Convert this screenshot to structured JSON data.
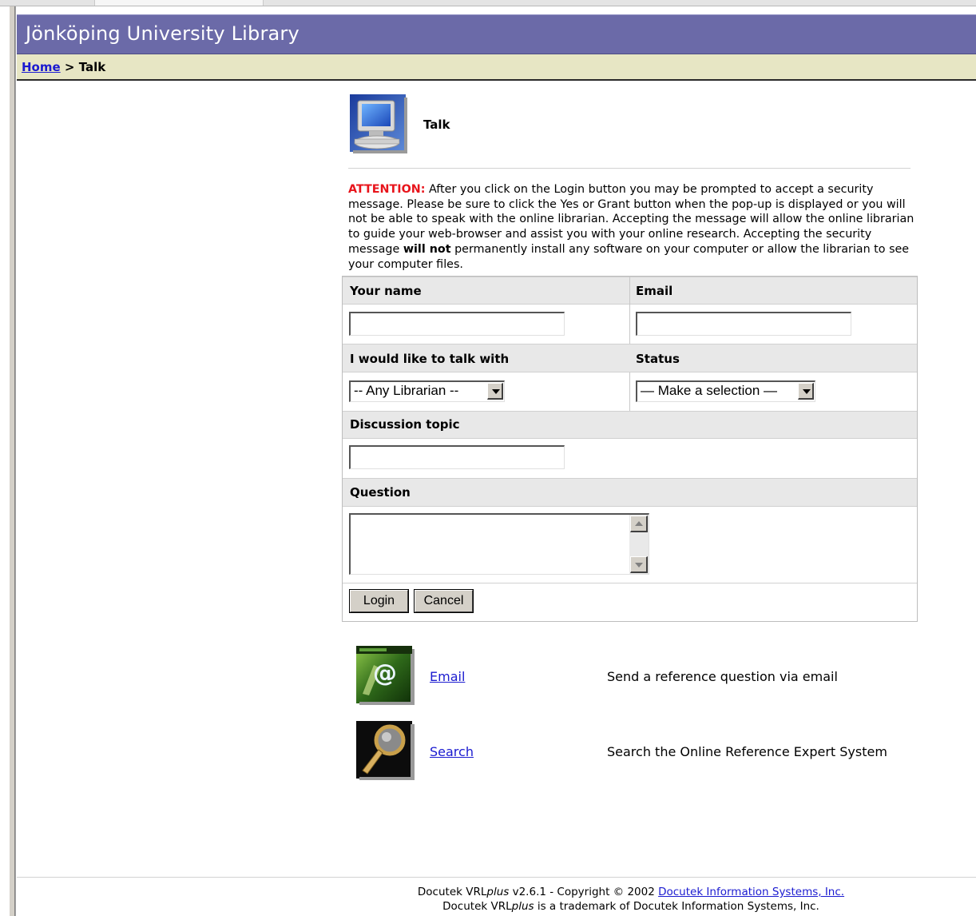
{
  "header": {
    "title": "Jönköping University Library"
  },
  "breadcrumb": {
    "home": "Home",
    "separator": ">",
    "current": "Talk"
  },
  "page": {
    "title": "Talk"
  },
  "attention": {
    "label": "ATTENTION:",
    "text_before": "After you click on the Login button you may be prompted to accept a security message. Please be sure to click the Yes or Grant button when the pop-up is displayed or you will not be able to speak with the online librarian. Accepting the message will allow the online librarian to guide your web-browser and assist you with your online research. Accepting the security message",
    "emphasis": "will not",
    "text_after": "permanently install any software on your computer or allow the librarian to see your computer files."
  },
  "form": {
    "name_label": "Your name",
    "name_value": "",
    "email_label": "Email",
    "email_value": "",
    "talk_with_label": "I would like to talk with",
    "talk_with_selected": "-- Any Librarian --",
    "status_label": "Status",
    "status_selected": "— Make a selection —",
    "topic_label": "Discussion topic",
    "topic_value": "",
    "question_label": "Question",
    "question_value": "",
    "login_label": "Login",
    "cancel_label": "Cancel"
  },
  "links": [
    {
      "label": "Email",
      "description": "Send a reference question via email",
      "icon": "email-at-icon"
    },
    {
      "label": "Search",
      "description": "Search the Online Reference Expert System",
      "icon": "magnifying-glass-icon"
    }
  ],
  "footer": {
    "line1_prefix": "Docutek VRL",
    "line1_plus": "plus",
    "line1_middle": " v2.6.1 - Copyright © 2002 ",
    "line1_link": "Docutek Information Systems, Inc.",
    "line2_prefix": "Docutek VRL",
    "line2_plus": "plus",
    "line2_suffix": " is a trademark of Docutek Information Systems, Inc."
  },
  "colors": {
    "header_bg": "#6b6aa8",
    "breadcrumb_bg": "#e7e6c4",
    "attention_red": "#e8141b",
    "link_blue": "#1b1bd0",
    "label_row_bg": "#e8e8e8"
  }
}
